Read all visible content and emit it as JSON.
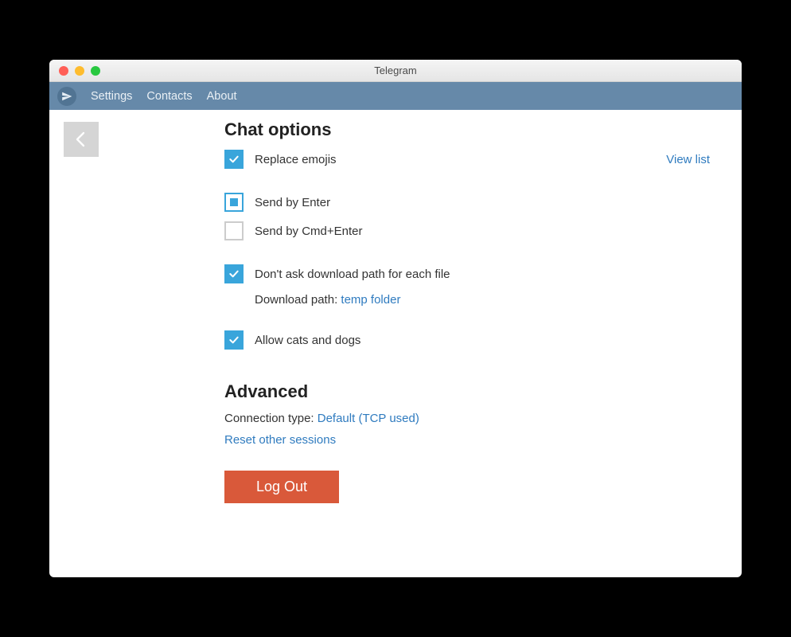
{
  "window": {
    "title": "Telegram"
  },
  "menubar": {
    "settings": "Settings",
    "contacts": "Contacts",
    "about": "About"
  },
  "chat_options": {
    "heading": "Chat options",
    "replace_emojis": "Replace emojis",
    "view_list": "View list",
    "send_by_enter": "Send by Enter",
    "send_by_cmd_enter": "Send by Cmd+Enter",
    "dont_ask_download": "Don't ask download path for each file",
    "download_path_label": "Download path: ",
    "download_path_link": "temp folder",
    "allow_cats_dogs": "Allow cats and dogs"
  },
  "advanced": {
    "heading": "Advanced",
    "conn_type_label": "Connection type: ",
    "conn_type_value": "Default (TCP used)",
    "reset_sessions": "Reset other sessions",
    "logout": "Log Out"
  }
}
